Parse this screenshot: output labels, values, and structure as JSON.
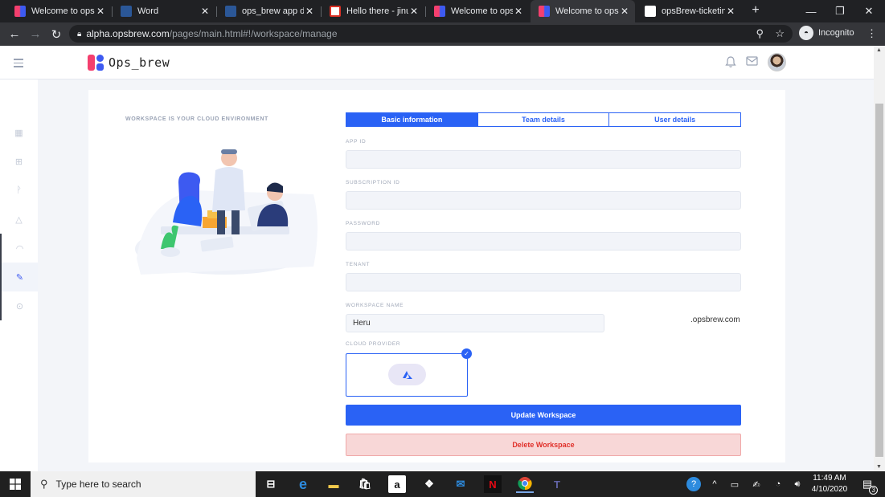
{
  "browser": {
    "tabs": [
      {
        "title": "Welcome to opsbr",
        "favicon": "opsbrew-logo-icon"
      },
      {
        "title": "Word",
        "favicon": "word-icon"
      },
      {
        "title": "ops_brew app doc",
        "favicon": "word-icon"
      },
      {
        "title": "Hello there - jinut",
        "favicon": "gmail-icon"
      },
      {
        "title": "Welcome to opsbr",
        "favicon": "opsbrew-logo-icon"
      },
      {
        "title": "Welcome to opsbr",
        "favicon": "opsbrew-logo-icon"
      },
      {
        "title": "opsBrew-ticketing",
        "favicon": "trello-icon"
      }
    ],
    "close_glyph": "✕",
    "new_tab_glyph": "+",
    "url_host": "alpha.opsbrew.com",
    "url_path": "/pages/main.html#!/workspace/manage",
    "incognito_label": "Incognito"
  },
  "app": {
    "brand": "Ops_brew",
    "tagline": "WORKSPACE IS YOUR CLOUD ENVIRONMENT",
    "tabs": [
      {
        "label": "Basic information",
        "active": true
      },
      {
        "label": "Team details",
        "active": false
      },
      {
        "label": "User details",
        "active": false
      }
    ],
    "fields": {
      "app_id_label": "APP ID",
      "app_id_value": "",
      "subscription_label": "SUBSCRIPTION ID",
      "subscription_value": "",
      "password_label": "PASSWORD",
      "password_value": "",
      "tenant_label": "TENANT",
      "tenant_value": "",
      "workspace_label": "WORKSPACE NAME",
      "workspace_value": "Heru",
      "workspace_suffix": ".opsbrew.com",
      "provider_label": "CLOUD PROVIDER"
    },
    "update_label": "Update Workspace",
    "delete_label": "Delete Workspace"
  },
  "taskbar": {
    "search_placeholder": "Type here to search",
    "time": "11:49 AM",
    "date": "4/10/2020",
    "notification_count": "3"
  },
  "colors": {
    "accent": "#2a62f5",
    "danger": "#e0302a",
    "danger_bg": "#f8d7d7",
    "logo_pink": "#f43f6e",
    "logo_blue": "#3d5af1"
  }
}
